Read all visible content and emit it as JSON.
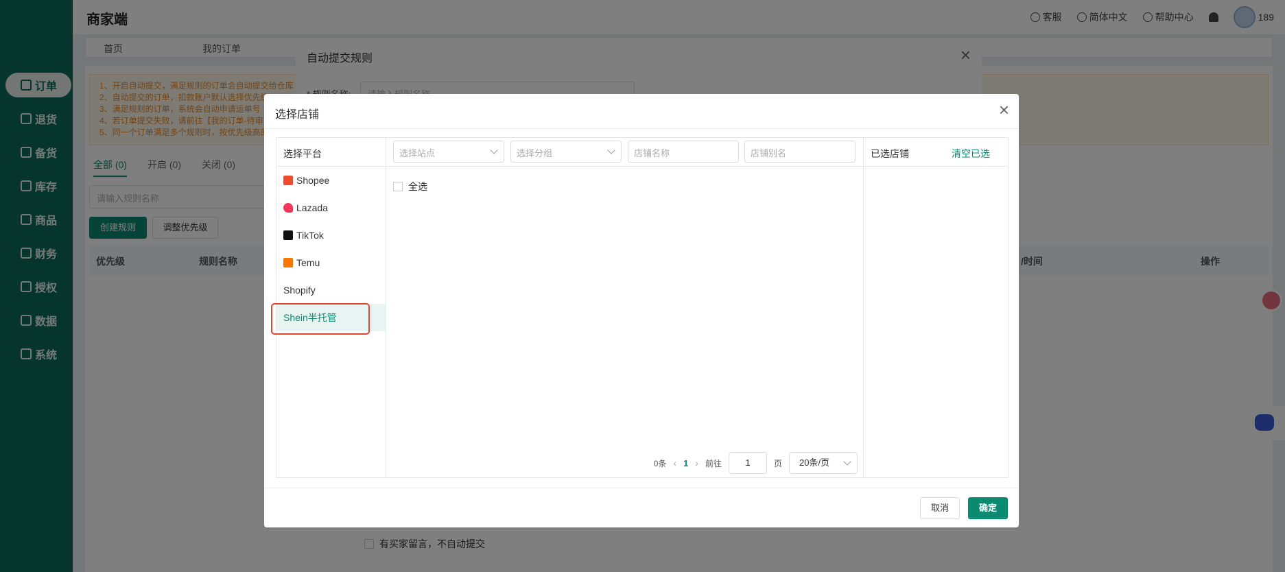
{
  "app": {
    "brand": "商家端",
    "top_right": {
      "service": "客服",
      "language": "简体中文",
      "help": "帮助中心",
      "user": "189"
    }
  },
  "sidebar": {
    "items": [
      {
        "label": "订单",
        "icon": "order-icon"
      },
      {
        "label": "退货",
        "icon": "return-icon"
      },
      {
        "label": "备货",
        "icon": "stock-prep-icon"
      },
      {
        "label": "库存",
        "icon": "inventory-icon"
      },
      {
        "label": "商品",
        "icon": "product-icon"
      },
      {
        "label": "财务",
        "icon": "finance-icon"
      },
      {
        "label": "授权",
        "icon": "auth-icon"
      },
      {
        "label": "数据",
        "icon": "data-icon"
      },
      {
        "label": "系统",
        "icon": "system-icon"
      }
    ]
  },
  "tabsbar": {
    "items": [
      "首页",
      "我的订单"
    ]
  },
  "content": {
    "notice_lines": [
      "1、开启自动提交，满足规则的订单会自动提交给仓库",
      "2、自动提交的订单，扣款账户默认选择优先级",
      "3、满足规则的订单，系统会自动申请运单号",
      "4、若订单提交失败，请前往【我的订单-待审",
      "5、同一个订单满足多个规则时，按优先级高的"
    ],
    "tabs": [
      "全部 (0)",
      "开启 (0)",
      "关闭 (0)"
    ],
    "search_placeholder": "请输入规则名称",
    "create_btn": "创建规则",
    "priority_btn": "调整优先级",
    "columns": {
      "priority": "优先级",
      "name": "规则名称",
      "time": "/时间",
      "action": "操作"
    }
  },
  "rule_dialog": {
    "title": "自动提交规则",
    "name_label": "* 规则名称:",
    "name_placeholder": "请输入规则名称",
    "message_option": "有买家留言，不自动提交"
  },
  "store_dialog": {
    "title": "选择店铺",
    "platform_header": "选择平台",
    "platforms": [
      {
        "label": "Shopee",
        "logo_color": "#ee4d2d"
      },
      {
        "label": "Lazada",
        "logo_color": "#f5365c"
      },
      {
        "label": "TikTok",
        "logo_color": "#111111"
      },
      {
        "label": "Temu",
        "logo_color": "#fb7701"
      },
      {
        "label": "Shopify",
        "logo_color": ""
      },
      {
        "label": "Shein半托管",
        "logo_color": ""
      }
    ],
    "active_platform": "Shein半托管",
    "filters": {
      "site_placeholder": "选择站点",
      "group_placeholder": "选择分组",
      "store_name_placeholder": "店铺名称",
      "store_alias_placeholder": "店铺别名"
    },
    "select_all": "全选",
    "pager": {
      "total": "0条",
      "current": "1",
      "goto": "前往",
      "page_input": "1",
      "page_unit": "页",
      "page_size": "20条/页"
    },
    "selected_header": "已选店铺",
    "clear_selected": "清空已选",
    "cancel": "取消",
    "confirm": "确定"
  },
  "colors": {
    "primary": "#0b8a72",
    "sidebar": "#0b6b5a",
    "highlight": "#e0452f"
  }
}
